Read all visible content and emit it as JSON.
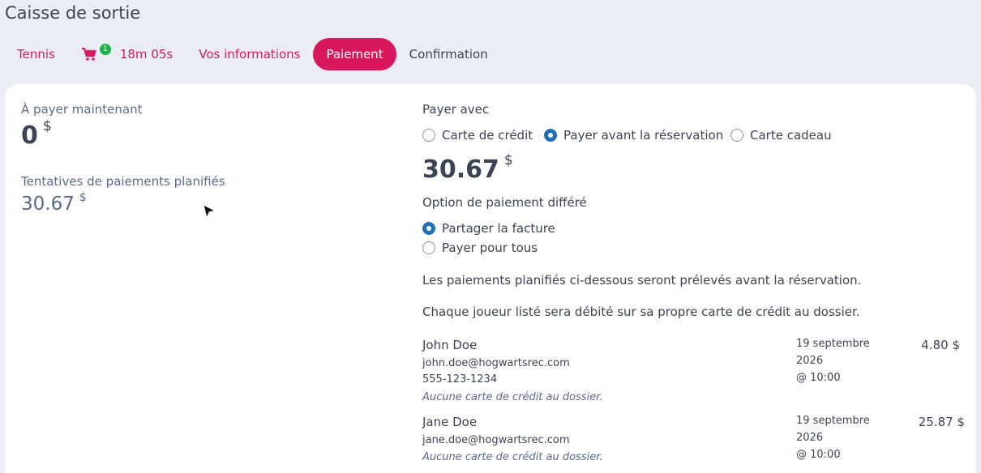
{
  "page": {
    "title": "Caisse de sortie"
  },
  "steps": {
    "tennis": "Tennis",
    "cart_count": "1",
    "timer": "18m 05s",
    "info": "Vos informations",
    "payment": "Paiement",
    "confirmation": "Confirmation"
  },
  "left": {
    "pay_now_label": "À payer maintenant",
    "pay_now_amount": "0",
    "currency": "$",
    "planned_label": "Tentatives de paiements planifiés",
    "planned_amount": "30.67"
  },
  "right": {
    "pay_with_label": "Payer avec",
    "methods": [
      {
        "label": "Carte de crédit",
        "checked": false
      },
      {
        "label": "Payer avant la réservation",
        "checked": true
      },
      {
        "label": "Carte cadeau",
        "checked": false
      }
    ],
    "total_amount": "30.67",
    "currency": "$",
    "deferred_label": "Option de paiement différé",
    "deferred_options": [
      {
        "label": "Partager la facture",
        "checked": true
      },
      {
        "label": "Payer pour tous",
        "checked": false
      }
    ],
    "info_line_1": "Les paiements planifiés ci-dessous seront prélevés avant la réservation.",
    "info_line_2": "Chaque joueur listé sera débité sur sa propre carte de crédit au dossier."
  },
  "players": [
    {
      "name": "John Doe",
      "email": "john.doe@hogwartsrec.com",
      "phone": "555-123-1234",
      "note": "Aucune carte de crédit au dossier.",
      "date_line_1": "19 septembre",
      "date_line_2": "2026",
      "time": "@ 10:00",
      "amount": "4.80 $"
    },
    {
      "name": "Jane Doe",
      "email": "jane.doe@hogwartsrec.com",
      "note": "Aucune carte de crédit au dossier.",
      "date_line_1": "19 septembre",
      "date_line_2": "2026",
      "time": "@ 10:00",
      "amount": "25.87 $"
    }
  ],
  "colors": {
    "accent": "#d8175d",
    "radio": "#1f6fb8",
    "badge": "#20b24a",
    "background": "#eaedf5"
  }
}
